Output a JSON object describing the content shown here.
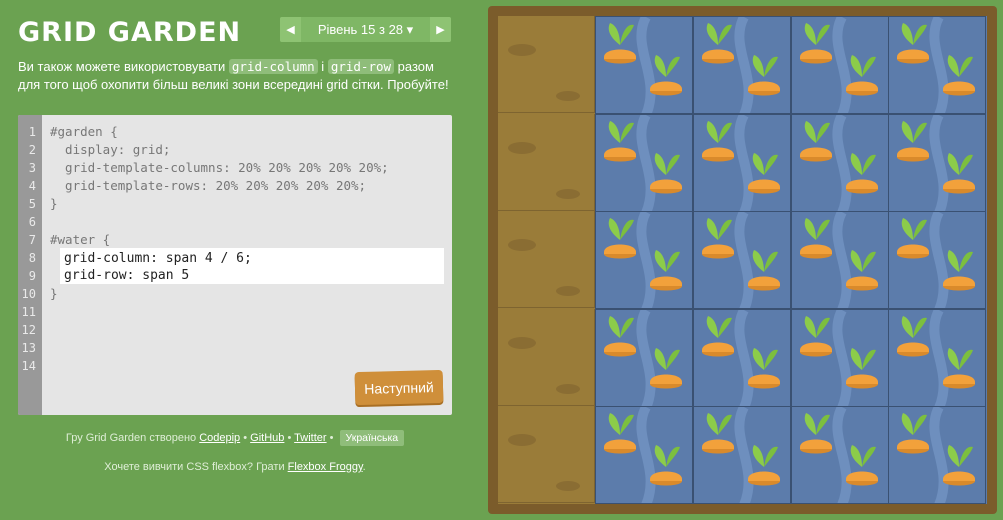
{
  "app": {
    "title": "GRID GARDEN"
  },
  "level_nav": {
    "prev_icon": "◀",
    "next_icon": "▶",
    "label": "Рівень 15 з 28 ▾"
  },
  "instructions": {
    "part1": "Ви також можете використовувати ",
    "code1": "grid-column",
    "part2": " і ",
    "code2": "grid-row",
    "part3": " разом для того щоб охопити більш великі зони всередині grid сітки. Пробуйте!"
  },
  "editor": {
    "line_numbers": [
      "1",
      "2",
      "3",
      "4",
      "5",
      "6",
      "7",
      "8",
      "9",
      "10",
      "11",
      "12",
      "13",
      "14"
    ],
    "lines_before": [
      "#garden {",
      "  display: grid;",
      "  grid-template-columns: 20% 20% 20% 20% 20%;",
      "  grid-template-rows: 20% 20% 20% 20% 20%;",
      "}",
      "",
      "#water {"
    ],
    "input_lines": [
      "grid-column: span 4 / 6;",
      "grid-row: span 5"
    ],
    "closing": "}",
    "next_button": "Наступний"
  },
  "footer": {
    "credit_prefix": "Гру Grid Garden створено ",
    "codepip": "Codepip",
    "sep": " • ",
    "github": "GitHub",
    "twitter": "Twitter",
    "language": "Українська",
    "flexbox_prefix": "Хочете вивчити CSS flexbox? Грати ",
    "flexbox_link": "Flexbox Froggy",
    "flexbox_suffix": "."
  },
  "colors": {
    "background": "#6ba251",
    "water": "#5c7cab",
    "soil": "#9a7c39",
    "carrot": "#f2a13b",
    "leaf": "#8ccc4a"
  },
  "garden": {
    "rows": 5,
    "cols": 5,
    "water_columns": [
      2,
      3,
      4,
      5
    ],
    "soil_columns": [
      1
    ]
  }
}
